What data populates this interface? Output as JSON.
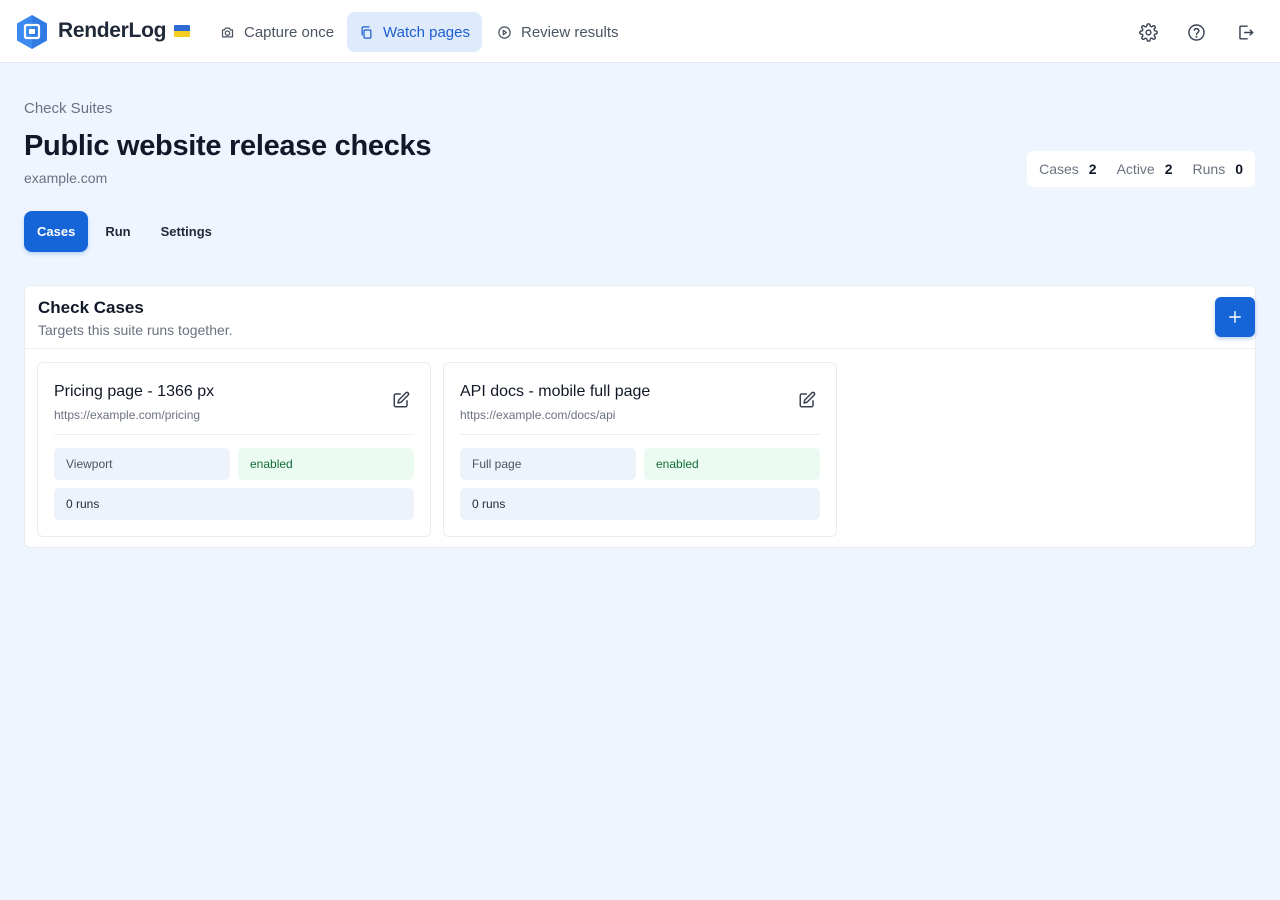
{
  "app": {
    "brand": "RenderLog",
    "accent_color": "#1565d8",
    "flag": "ukraine-flag"
  },
  "nav": [
    {
      "label": "Capture once",
      "icon": "camera-icon",
      "active": false
    },
    {
      "label": "Watch pages",
      "icon": "copy-icon",
      "active": true
    },
    {
      "label": "Review results",
      "icon": "play-circle-icon",
      "active": false
    }
  ],
  "toolbar": {
    "icons": [
      "settings-icon",
      "help-icon",
      "logout-icon"
    ]
  },
  "header": {
    "breadcrumb": "Check Suites",
    "title": "Public website release checks",
    "domain": "example.com"
  },
  "stats": [
    {
      "label": "Cases",
      "value": "2"
    },
    {
      "label": "Active",
      "value": "2"
    },
    {
      "label": "Runs",
      "value": "0"
    }
  ],
  "tabs": [
    {
      "label": "Cases",
      "active": true
    },
    {
      "label": "Run",
      "active": false
    },
    {
      "label": "Settings",
      "active": false
    }
  ],
  "panel": {
    "title": "Check Cases",
    "subtitle": "Targets this suite runs together.",
    "add_icon": "plus-icon"
  },
  "cases": [
    {
      "title": "Pricing page - 1366 px",
      "url": "https://example.com/pricing",
      "mode": "Viewport",
      "state": "enabled",
      "runs": "0 runs"
    },
    {
      "title": "API docs - mobile full page",
      "url": "https://example.com/docs/api",
      "mode": "Full page",
      "state": "enabled",
      "runs": "0 runs"
    }
  ]
}
